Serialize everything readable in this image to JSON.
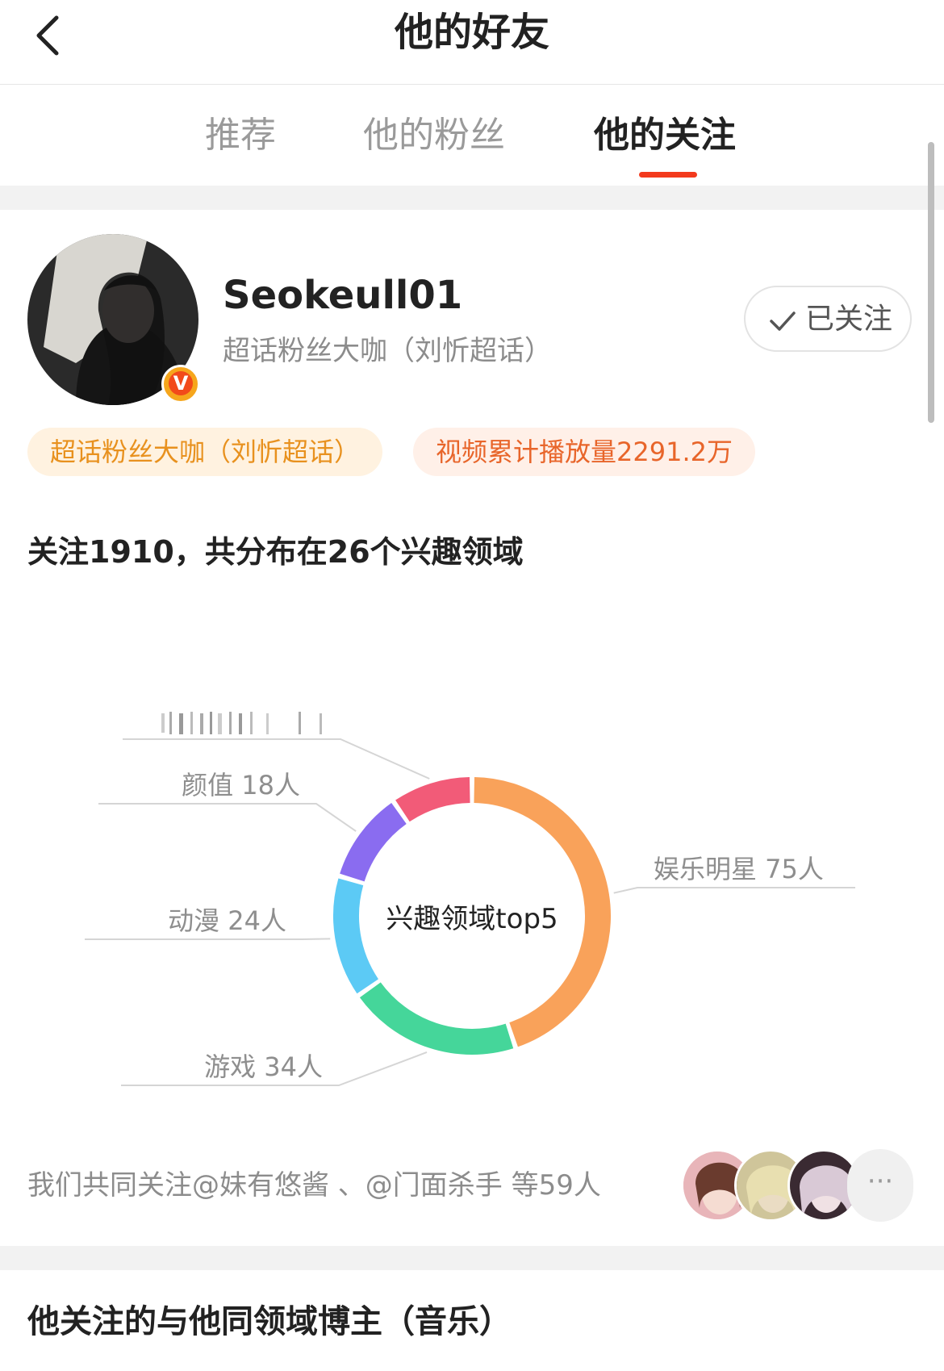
{
  "header": {
    "title": "他的好友",
    "back_icon": "chevron-left-icon"
  },
  "tabs": [
    {
      "label": "推荐",
      "active": false
    },
    {
      "label": "他的粉丝",
      "active": false
    },
    {
      "label": "他的关注",
      "active": true
    }
  ],
  "accent": "#f33a1d",
  "profile": {
    "name": "Seokeull01",
    "subtitle": "超话粉丝大咖（刘忻超话）",
    "follow_label": "已关注",
    "follow_icon": "checkmark-icon",
    "verified_badge": "V",
    "tags": [
      "超话粉丝大咖（刘忻超话）",
      "视频累计播放量2291.2万"
    ]
  },
  "summary": "关注1910，共分布在26个兴趣领域",
  "chart_data": {
    "type": "pie",
    "style": "donut",
    "center_label": "兴趣领域top5",
    "slices": [
      {
        "label": "娱乐明星 75人",
        "value": 75,
        "color": "#f9a25a"
      },
      {
        "label": "游戏 34人",
        "value": 34,
        "color": "#45d69a"
      },
      {
        "label": "动漫 24人",
        "value": 24,
        "color": "#5ccaf5"
      },
      {
        "label": "颜值 18人",
        "value": 18,
        "color": "#8a6cf0"
      },
      {
        "label": "",
        "value": 16,
        "color": "#f25b78"
      }
    ]
  },
  "common": {
    "text": "我们共同关注@妹有悠酱 、@门面杀手 等59人",
    "more_label": "···"
  },
  "section2_title": "他关注的与他同领域博主（音乐）"
}
